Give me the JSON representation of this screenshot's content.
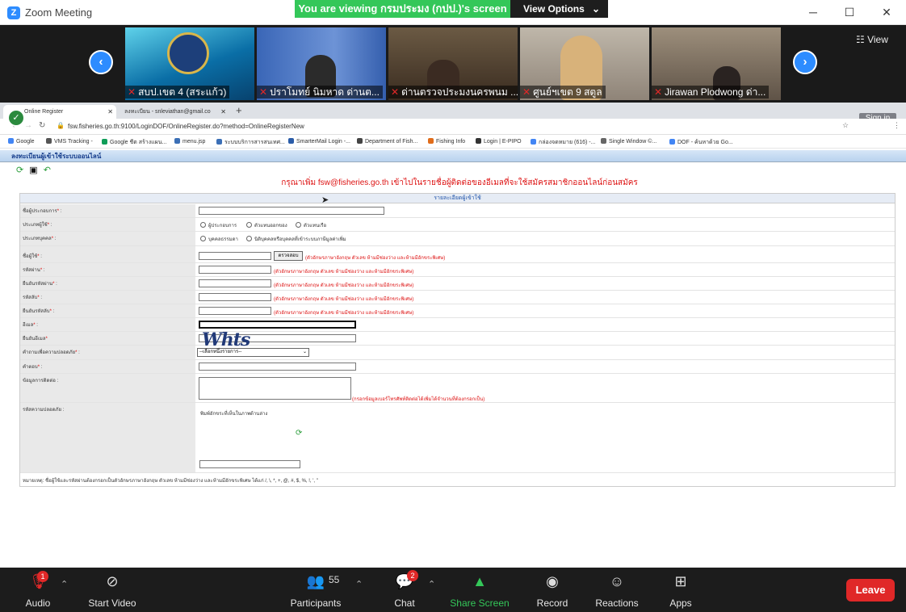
{
  "window": {
    "title": "Zoom Meeting",
    "minimize": "─",
    "maximize": "☐",
    "close": "✕"
  },
  "share_banner": {
    "text": "You are viewing กรมประมง (กปป.)'s screen",
    "view_options": "View Options",
    "chevron": "⌄"
  },
  "gallery": {
    "prev": "‹",
    "next": "›",
    "view_label": "☷ View",
    "tiles": [
      {
        "name": "สบป.เขต 4 (สระแก้ว)"
      },
      {
        "name": "ปราโมทย์ นิมหาด ด่านต..."
      },
      {
        "name": "ด่านตรวจประมงนครพนม ..."
      },
      {
        "name": "ศูนย์ฯเขต 9 สตูล"
      },
      {
        "name": "Jirawan Plodwong ด่า..."
      }
    ]
  },
  "browser": {
    "tabs": [
      {
        "title": "Online Register",
        "close": "✕"
      },
      {
        "title": "ลงทะเบียน - snleviathan@gmail.co",
        "close": "✕"
      }
    ],
    "new_tab": "+",
    "sign_in": "Sign in",
    "url": "fsw.fisheries.go.th:9100/LoginDOF/OnlineRegister.do?method=OnlineRegisterNew",
    "bookmarks": [
      {
        "label": "Google",
        "color": "#4285f4"
      },
      {
        "label": "VMS Tracking -",
        "color": "#555555"
      },
      {
        "label": "Google ชีต สร้างแผน...",
        "color": "#0f9d58"
      },
      {
        "label": "menu.jsp",
        "color": "#3b6fb6"
      },
      {
        "label": "ระบบบริการสารสนเทศ...",
        "color": "#3b6fb6"
      },
      {
        "label": "SmarterMail Login -...",
        "color": "#2a5ca8"
      },
      {
        "label": "Department of Fish...",
        "color": "#444444"
      },
      {
        "label": "Fishing Info",
        "color": "#e06c1a"
      },
      {
        "label": "Login | E-PIPO",
        "color": "#333333"
      },
      {
        "label": "กล่องจดหมาย (616) -...",
        "color": "#4285f4"
      },
      {
        "label": "Single Window ©...",
        "color": "#666666"
      },
      {
        "label": "DOF - ค้นหาด้วย Go...",
        "color": "#4285f4"
      }
    ]
  },
  "page": {
    "header": "ลงทะเบียนผู้เข้าใช้ระบบออนไลน์",
    "notice": "กรุณาเพิ่ม fsw@fisheries.go.th เข้าไปในรายชื่อผู้ติดต่อของอีเมลก่อนสมัครสมาชิกออนไลน์",
    "notice_parts": {
      "before": "กรุณาเพิ่ม ",
      "email": "fsw@fisheries.go.th",
      "after": " เข้าไปในรายชื่อผู้ติดต่อของอีเมลที่จะใช้สมัครสมาชิกออนไลน์ก่อนสมัคร"
    },
    "form_title": "รายละเอียดผู้เข้าใช้",
    "fields": {
      "org": "ชื่อผู้ประกอบการ",
      "user_type": "ประเภทผู้ใช้",
      "user_type_opts": [
        "ผู้ประกอบการ",
        "ตัวแทนออกของ",
        "ตัวแทนเรือ"
      ],
      "person_type": "ประเภทบุคคล",
      "person_type_opts": [
        "บุคคลธรรมดา",
        "นิติบุคคลหรือบุคคลที่เข้าระบบภาษีมูลค่าเพิ่ม"
      ],
      "username": "ชื่อผู้ใช้",
      "check_btn": "ตรวจสอบ",
      "password": "รหัสผ่าน",
      "password_confirm": "ยืนยันรหัสผ่าน",
      "pin": "รหัสลับ",
      "pin_confirm": "ยืนยันรหัสลับ",
      "email": "อีเมล",
      "email_confirm": "ยืนยันอีเมล",
      "question": "คำถามเพื่อความปลอดภัย",
      "question_placeholder": "--เลือกหนึ่งรายการ--",
      "answer": "คำตอบ",
      "extra": "ข้อมูลการติดต่อ",
      "captcha": "รหัสความปลอดภัย",
      "captcha_prompt": "พิมพ์อักขระที่เห็นในภาพด้านล่าง",
      "captcha_text": "Whts",
      "username_hint": "(ตัวอักษรภาษาอังกฤษ ตัวเลข ห้ามมีช่องว่าง และห้ามมีอักขระพิเศษ)",
      "field_hint": "(ตัวอักษรภาษาอังกฤษ ตัวเลข ห้ามมีช่องว่าง และห้ามมีอักขระพิเศษ)",
      "extra_hint": "(กรอกข้อมูลเบอร์โทรศัพท์ติดต่อได้เพิ่มได้จำนวนที่ต้องกรอกเป็น)",
      "footnote": "หมายเหตุ: ชื่อผู้ใช้และรหัสผ่านต้องกรอกเป็นตัวอักษรภาษาอังกฤษ ตัวเลข ห้ามมีช่องว่าง และห้ามมีอักขระพิเศษ ได้แก่ /, \\, *, +, @, #, $, %, !, ', \""
    }
  },
  "toolbar": {
    "audio": "Audio",
    "audio_badge": "1",
    "video": "Start Video",
    "participants": "Participants",
    "participants_count": "55",
    "chat": "Chat",
    "chat_badge": "2",
    "share": "Share Screen",
    "record": "Record",
    "reactions": "Reactions",
    "apps": "Apps",
    "leave": "Leave"
  },
  "colors": {
    "zoom_blue": "#2d8cff",
    "share_green": "#34c759",
    "leave_red": "#e02828"
  }
}
